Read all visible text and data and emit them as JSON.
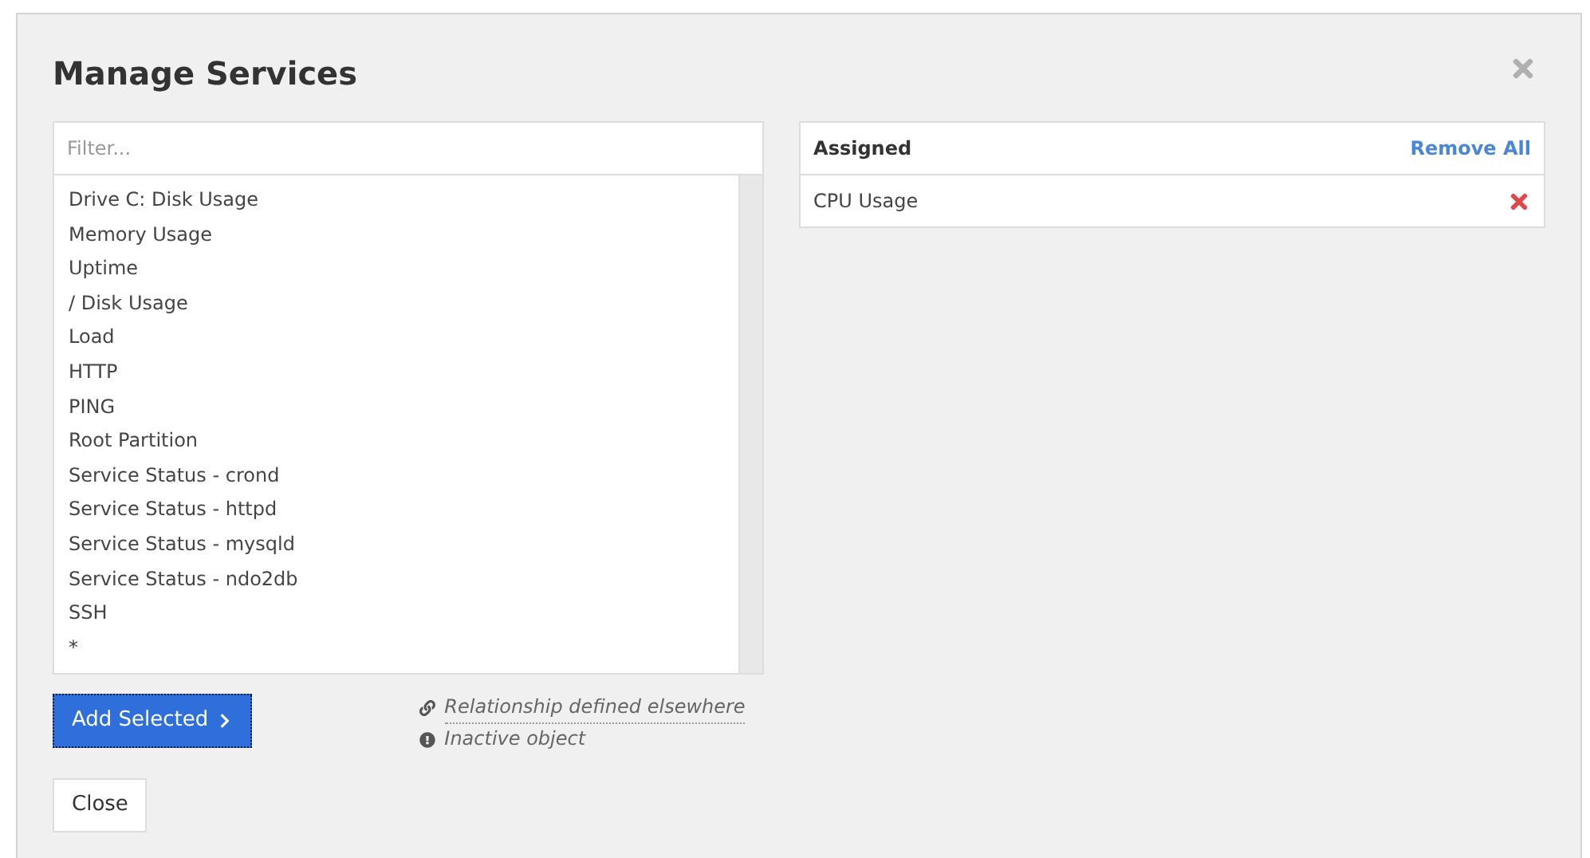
{
  "dialog": {
    "title": "Manage Services"
  },
  "filter": {
    "placeholder": "Filter..."
  },
  "available": [
    {
      "label": "Drive C: Disk Usage"
    },
    {
      "label": "Memory Usage"
    },
    {
      "label": "Uptime"
    },
    {
      "label": "/ Disk Usage"
    },
    {
      "label": "Load"
    },
    {
      "label": "HTTP"
    },
    {
      "label": "PING"
    },
    {
      "label": "Root Partition"
    },
    {
      "label": "Service Status - crond"
    },
    {
      "label": "Service Status - httpd"
    },
    {
      "label": "Service Status - mysqld"
    },
    {
      "label": "Service Status - ndo2db"
    },
    {
      "label": "SSH"
    },
    {
      "label": "*"
    }
  ],
  "add_button": "Add Selected",
  "legend": [
    {
      "kind": "link",
      "text": "Relationship defined elsewhere"
    },
    {
      "kind": "inactive",
      "text": "Inactive object"
    }
  ],
  "close_button": "Close",
  "assigned": {
    "heading": "Assigned",
    "remove_all": "Remove All",
    "items": [
      {
        "label": "CPU Usage"
      }
    ]
  }
}
